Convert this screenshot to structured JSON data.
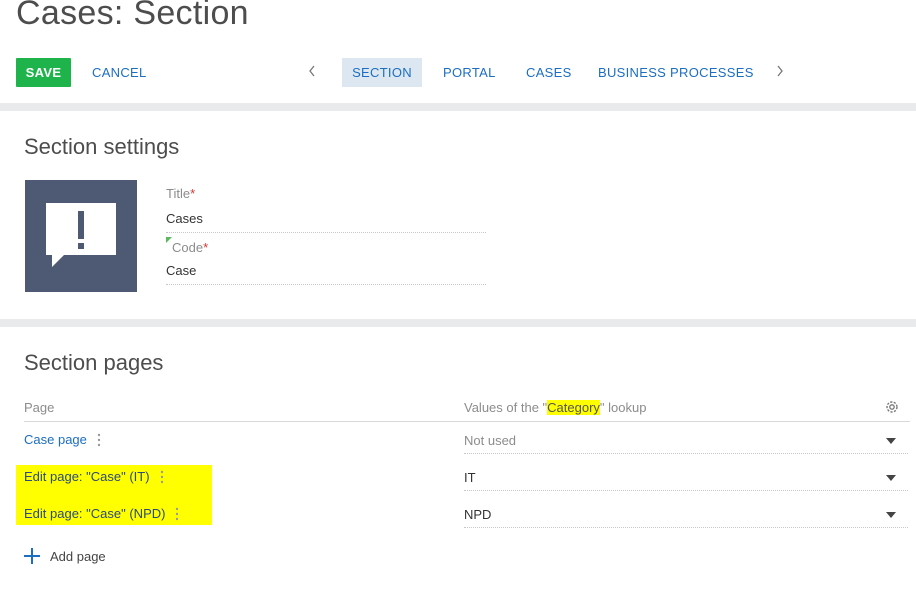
{
  "page": {
    "title": "Cases: Section"
  },
  "toolbar": {
    "save_label": "SAVE",
    "cancel_label": "CANCEL",
    "tabs": [
      {
        "label": "SECTION",
        "active": true
      },
      {
        "label": "PORTAL",
        "active": false
      },
      {
        "label": "CASES",
        "active": false
      },
      {
        "label": "BUSINESS PROCESSES",
        "active": false
      }
    ]
  },
  "settings": {
    "heading": "Section settings",
    "icon": "case-alert-icon",
    "fields": {
      "title": {
        "label": "Title",
        "required_mark": "*",
        "value": "Cases"
      },
      "code": {
        "label": "Code",
        "required_mark": "*",
        "value": "Case"
      }
    }
  },
  "pages_section": {
    "heading": "Section pages",
    "columns": {
      "page": "Page",
      "values_prefix": "Values of the \"",
      "values_highlight": "Category",
      "values_suffix": "\" lookup"
    },
    "rows": [
      {
        "page": "Case page",
        "value": "Not used"
      },
      {
        "page": "Edit page: \"Case\" (IT)",
        "value": "IT"
      },
      {
        "page": "Edit page: \"Case\" (NPD)",
        "value": "NPD"
      }
    ],
    "add_label": "Add page"
  },
  "colors": {
    "save_green": "#1eb44b",
    "link_blue": "#1b6ec2",
    "active_tab_bg": "#dde7f1",
    "icon_tile": "#4e5a74",
    "highlight": "#ffff00"
  }
}
